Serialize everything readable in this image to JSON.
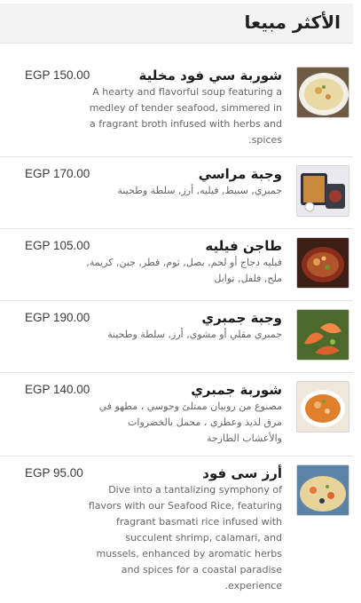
{
  "section": {
    "title": "الأكثر مبيعا"
  },
  "items": [
    {
      "name": "شوربة سي فود مخلية",
      "price": "EGP 150.00",
      "description": "A hearty and flavorful soup featuring a medley of tender seafood, simmered in a fragrant broth infused with herbs and spices.",
      "image_icon": "seafood-soup-image"
    },
    {
      "name": "وجبة مراسي",
      "price": "EGP 170.00",
      "description": "جمبري, سبيط, فيليه, أرز, سلطة وطحينة",
      "image_icon": "seafood-meal-image"
    },
    {
      "name": "طاجن فيليه",
      "price": "EGP 105.00",
      "description": "فيليه دجاج أو لحم, بصل, ثوم, فطر, جبن, كريمة, ملح, فلفل, توابل",
      "image_icon": "tajine-image"
    },
    {
      "name": "وجبة جمبري",
      "price": "EGP 190.00",
      "description": "جمبري مقلي أو مشوي, أرز, سلطة وطحينة",
      "image_icon": "shrimp-image"
    },
    {
      "name": "شوربة جمبري",
      "price": "EGP 140.00",
      "description": "مصنوع من روبيان ممتلئ وجوسي ، مطهو في مرق لذيذ وعطري ، محمل بالخضروات والأعشاب الطازجة",
      "image_icon": "shrimp-soup-image"
    },
    {
      "name": "أرز سى فود",
      "price": "EGP 95.00",
      "description": "Dive into a tantalizing symphony of flavors with our Seafood Rice, featuring fragrant basmati rice infused with succulent shrimp, calamari, and mussels, enhanced by aromatic herbs and spices for a coastal paradise experience.",
      "image_icon": "seafood-rice-image"
    }
  ]
}
